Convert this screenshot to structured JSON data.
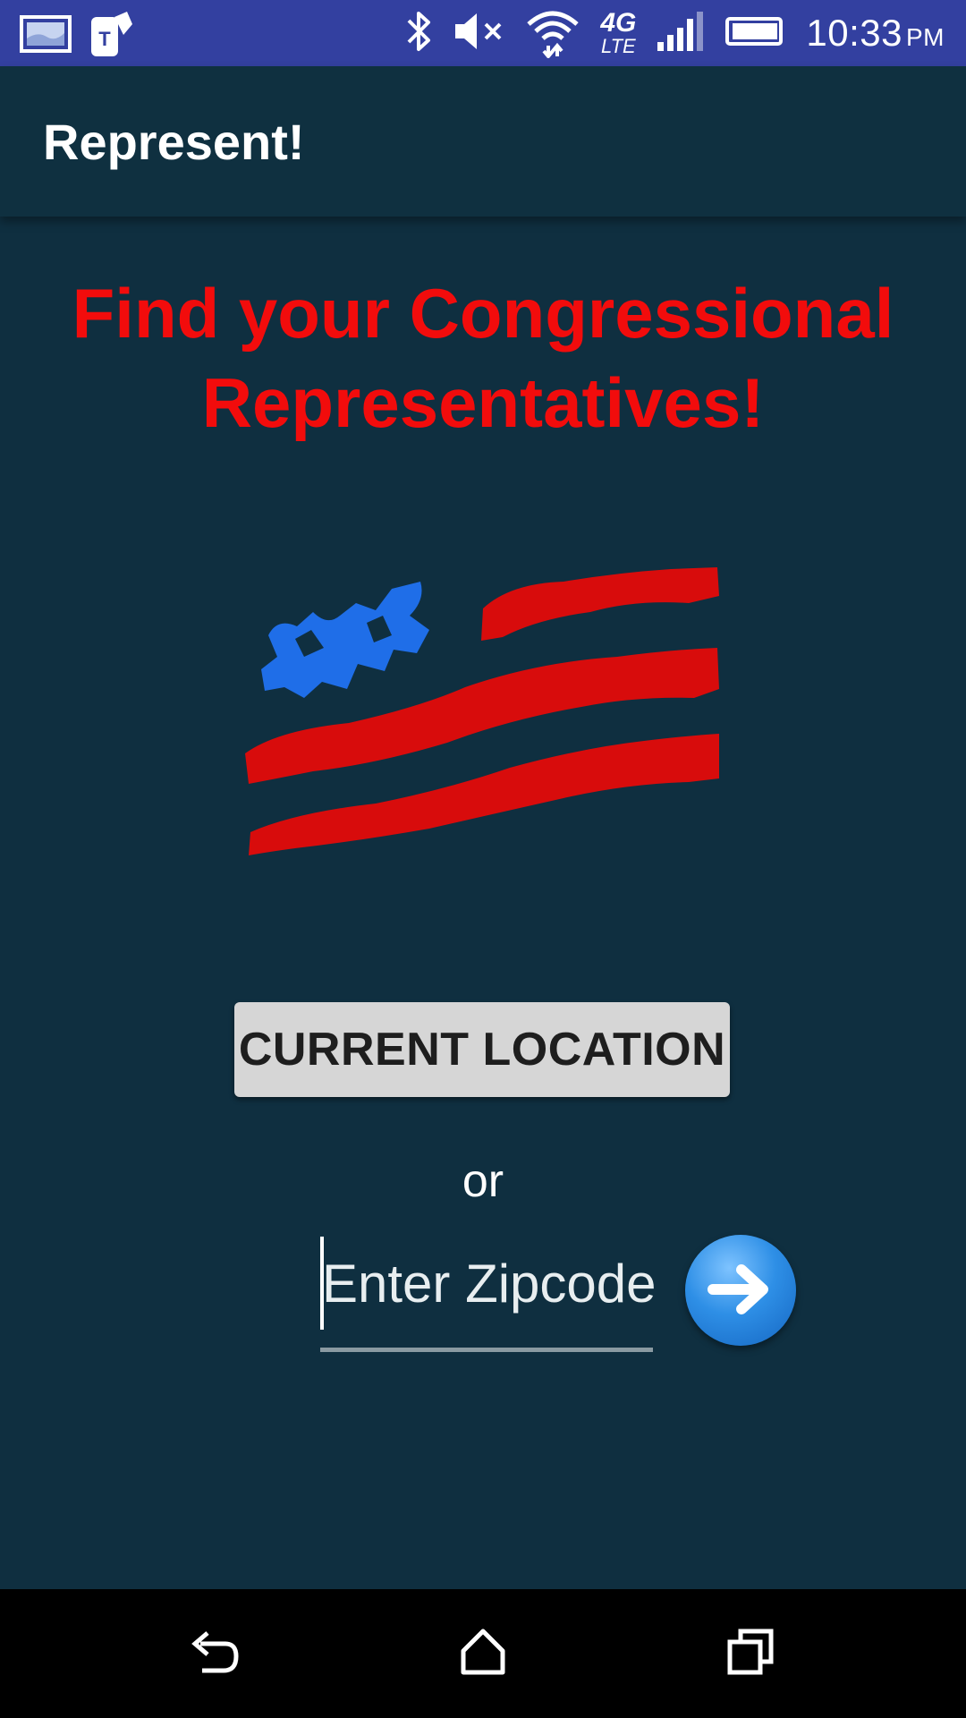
{
  "status_bar": {
    "time": "10:33",
    "ampm": "PM",
    "network": "4G",
    "network_sub": "LTE"
  },
  "app_bar": {
    "title": "Represent!"
  },
  "main": {
    "headline_line1": "Find your Congressional",
    "headline_line2": "Representatives!",
    "location_button_label": "CURRENT LOCATION",
    "or_label": "or",
    "zip_placeholder": "Enter Zipcode"
  },
  "icons": {
    "flag": "us-flag-icon",
    "go": "arrow-right-icon",
    "back": "back-icon",
    "home": "home-icon",
    "recents": "recents-icon"
  },
  "colors": {
    "status_bar": "#3340a0",
    "background": "#0f2f40",
    "headline": "#f20c0c",
    "flag_red": "#d80c0c",
    "flag_blue": "#1f6ee8",
    "button": "#d6d6d6",
    "go_button": "#2e8fe6"
  }
}
